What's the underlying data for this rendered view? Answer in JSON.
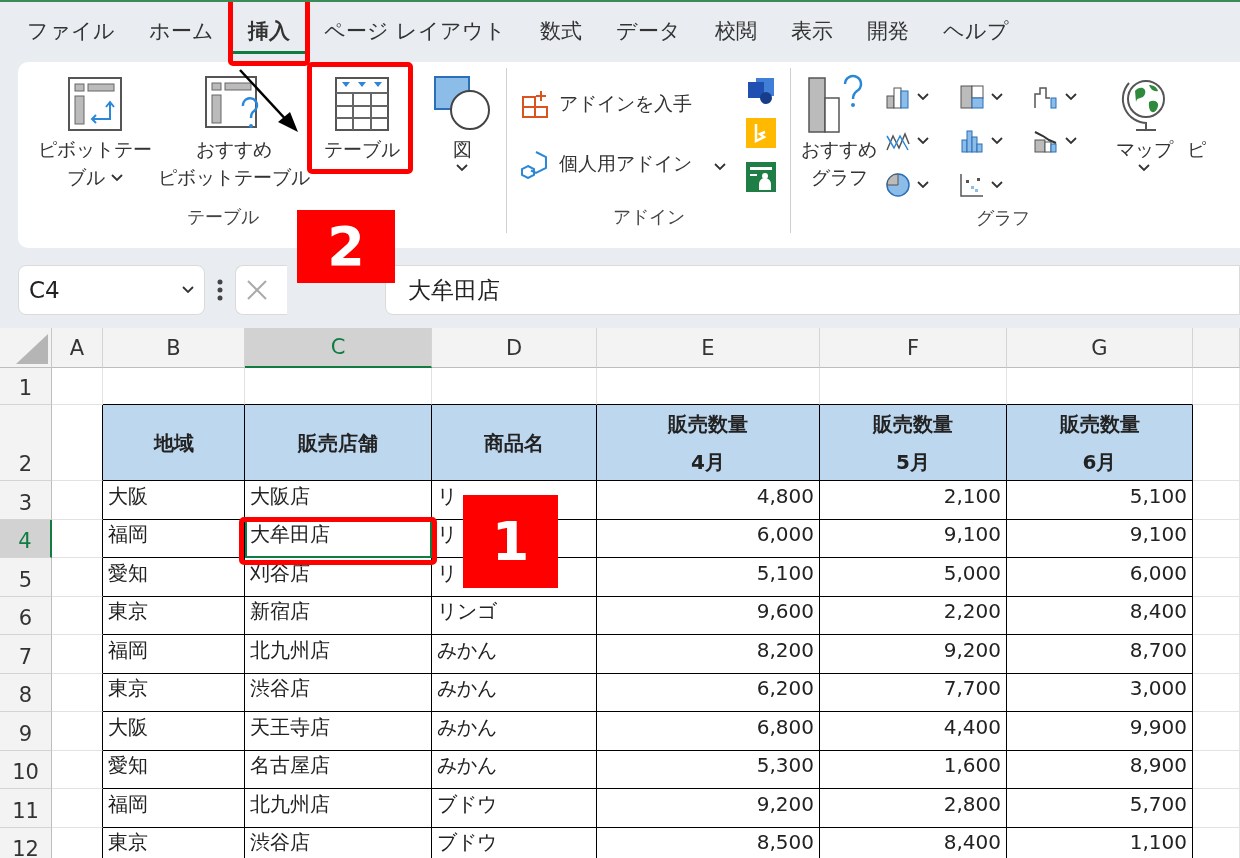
{
  "tabs": [
    {
      "label": "ファイル",
      "selected": false
    },
    {
      "label": "ホーム",
      "selected": false
    },
    {
      "label": "挿入",
      "selected": true,
      "highlighted": true
    },
    {
      "label": "ページ レイアウト",
      "selected": false
    },
    {
      "label": "数式",
      "selected": false
    },
    {
      "label": "データ",
      "selected": false
    },
    {
      "label": "校閲",
      "selected": false
    },
    {
      "label": "表示",
      "selected": false
    },
    {
      "label": "開発",
      "selected": false
    },
    {
      "label": "ヘルプ",
      "selected": false
    }
  ],
  "ribbon": {
    "groups": [
      {
        "label": "テーブル",
        "items": [
          {
            "kind": "pivot",
            "lines": [
              "ピボットテー",
              "ブル"
            ],
            "dropdown": true
          },
          {
            "kind": "suggest",
            "lines": [
              "おすすめ",
              "ピボットテーブル"
            ],
            "dropdown": false
          },
          {
            "kind": "table",
            "lines": [
              "テーブル"
            ],
            "dropdown": false,
            "highlighted": true
          }
        ]
      },
      {
        "items": [
          {
            "kind": "shape",
            "lines": [
              "図"
            ],
            "dropdown": true
          }
        ]
      },
      {
        "label": "アドイン",
        "addins": [
          {
            "kind": "store",
            "label": "アドインを入手",
            "dropdown": false
          },
          {
            "kind": "personal",
            "label": "個人用アドイン",
            "dropdown": true
          }
        ]
      },
      {
        "label": "グラフ",
        "items": [
          {
            "kind": "chart",
            "lines": [
              "おすすめ",
              "グラフ"
            ],
            "dropdown": false
          },
          {
            "kind": "gallery"
          },
          {
            "kind": "globe",
            "lines": [
              "マップ"
            ],
            "dropdown": true
          },
          {
            "kind": "plain",
            "lines": [
              "ピ"
            ],
            "dropdown": false
          }
        ]
      }
    ]
  },
  "formula_bar": {
    "name_box": "C4",
    "value": "大牟田店"
  },
  "sheet": {
    "columns": [
      {
        "label": "A",
        "selected": false,
        "kind": "text"
      },
      {
        "label": "B",
        "selected": false,
        "kind": "text"
      },
      {
        "label": "C",
        "selected": true,
        "kind": "text"
      },
      {
        "label": "D",
        "selected": false,
        "kind": "text"
      },
      {
        "label": "E",
        "selected": false,
        "kind": "number"
      },
      {
        "label": "F",
        "selected": false,
        "kind": "number"
      },
      {
        "label": "G",
        "selected": false,
        "kind": "number"
      }
    ],
    "rows": [
      {
        "number": "1",
        "selected": false
      },
      {
        "number": "2",
        "selected": false,
        "kind": "header",
        "cells": [
          {
            "text": "地域",
            "selected": false
          },
          {
            "text": "販売店舗",
            "selected": false
          },
          {
            "text": "商品名",
            "selected": false
          },
          {
            "text": "販売数量\n4月",
            "selected": false
          },
          {
            "text": "販売数量\n5月",
            "selected": false
          },
          {
            "text": "販売数量\n6月",
            "selected": false
          }
        ]
      },
      {
        "number": "3",
        "selected": false,
        "kind": "data",
        "cells": [
          {
            "text": "大阪",
            "selected": false
          },
          {
            "text": "大阪店",
            "selected": false
          },
          {
            "text": "リ",
            "selected": false
          },
          {
            "text": "4,800",
            "selected": false
          },
          {
            "text": "2,100",
            "selected": false
          },
          {
            "text": "5,100",
            "selected": false
          }
        ]
      },
      {
        "number": "4",
        "selected": true,
        "kind": "data",
        "cells": [
          {
            "text": "福岡",
            "selected": false
          },
          {
            "text": "大牟田店",
            "selected": true,
            "highlighted": true
          },
          {
            "text": "リ",
            "selected": false
          },
          {
            "text": "6,000",
            "selected": false
          },
          {
            "text": "9,100",
            "selected": false
          },
          {
            "text": "9,100",
            "selected": false
          }
        ]
      },
      {
        "number": "5",
        "selected": false,
        "kind": "data",
        "cells": [
          {
            "text": "愛知",
            "selected": false
          },
          {
            "text": "刈谷店",
            "selected": false
          },
          {
            "text": "リ",
            "selected": false
          },
          {
            "text": "5,100",
            "selected": false
          },
          {
            "text": "5,000",
            "selected": false
          },
          {
            "text": "6,000",
            "selected": false
          }
        ]
      },
      {
        "number": "6",
        "selected": false,
        "kind": "data",
        "cells": [
          {
            "text": "東京",
            "selected": false
          },
          {
            "text": "新宿店",
            "selected": false
          },
          {
            "text": "リンゴ",
            "selected": false
          },
          {
            "text": "9,600",
            "selected": false
          },
          {
            "text": "2,200",
            "selected": false
          },
          {
            "text": "8,400",
            "selected": false
          }
        ]
      },
      {
        "number": "7",
        "selected": false,
        "kind": "data",
        "cells": [
          {
            "text": "福岡",
            "selected": false
          },
          {
            "text": "北九州店",
            "selected": false
          },
          {
            "text": "みかん",
            "selected": false
          },
          {
            "text": "8,200",
            "selected": false
          },
          {
            "text": "9,200",
            "selected": false
          },
          {
            "text": "8,700",
            "selected": false
          }
        ]
      },
      {
        "number": "8",
        "selected": false,
        "kind": "data",
        "cells": [
          {
            "text": "東京",
            "selected": false
          },
          {
            "text": "渋谷店",
            "selected": false
          },
          {
            "text": "みかん",
            "selected": false
          },
          {
            "text": "6,200",
            "selected": false
          },
          {
            "text": "7,700",
            "selected": false
          },
          {
            "text": "3,000",
            "selected": false
          }
        ]
      },
      {
        "number": "9",
        "selected": false,
        "kind": "data",
        "cells": [
          {
            "text": "大阪",
            "selected": false
          },
          {
            "text": "天王寺店",
            "selected": false
          },
          {
            "text": "みかん",
            "selected": false
          },
          {
            "text": "6,800",
            "selected": false
          },
          {
            "text": "4,400",
            "selected": false
          },
          {
            "text": "9,900",
            "selected": false
          }
        ]
      },
      {
        "number": "10",
        "selected": false,
        "kind": "data",
        "cells": [
          {
            "text": "愛知",
            "selected": false
          },
          {
            "text": "名古屋店",
            "selected": false
          },
          {
            "text": "みかん",
            "selected": false
          },
          {
            "text": "5,300",
            "selected": false
          },
          {
            "text": "1,600",
            "selected": false
          },
          {
            "text": "8,900",
            "selected": false
          }
        ]
      },
      {
        "number": "11",
        "selected": false,
        "kind": "data",
        "cells": [
          {
            "text": "福岡",
            "selected": false
          },
          {
            "text": "北九州店",
            "selected": false
          },
          {
            "text": "ブドウ",
            "selected": false
          },
          {
            "text": "9,200",
            "selected": false
          },
          {
            "text": "2,800",
            "selected": false
          },
          {
            "text": "5,700",
            "selected": false
          }
        ]
      },
      {
        "number": "12",
        "selected": false,
        "kind": "data",
        "cells": [
          {
            "text": "東京",
            "selected": false
          },
          {
            "text": "渋谷店",
            "selected": false
          },
          {
            "text": "ブドウ",
            "selected": false
          },
          {
            "text": "8,500",
            "selected": false
          },
          {
            "text": "8,400",
            "selected": false
          },
          {
            "text": "1,100",
            "selected": false
          }
        ]
      }
    ]
  },
  "callouts": [
    {
      "label": "1"
    },
    {
      "label": "2"
    }
  ]
}
